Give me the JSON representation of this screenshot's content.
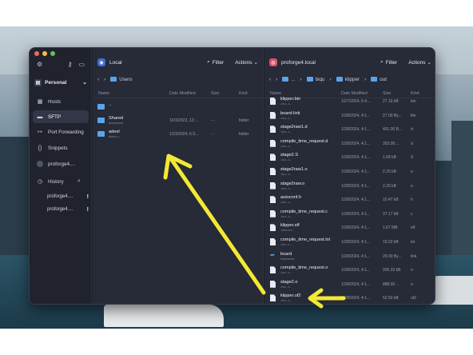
{
  "sidebar": {
    "vault_label": "Personal",
    "items": [
      {
        "label": "Hosts",
        "icon": "hosts-icon",
        "glyph": "▭"
      },
      {
        "label": "SFTP",
        "icon": "folder-icon",
        "glyph": "▬"
      },
      {
        "label": "Port Forwarding",
        "icon": "port-forwarding-icon",
        "glyph": "↦"
      },
      {
        "label": "Snippets",
        "icon": "snippets-icon",
        "glyph": "{}"
      },
      {
        "label": "proforge4....",
        "icon": "host-avatar-icon",
        "glyph": ""
      },
      {
        "label": "History",
        "icon": "history-icon",
        "glyph": "◷"
      }
    ],
    "history": [
      {
        "label": "proforge4....",
        "badge": "!"
      },
      {
        "label": "proforge4....",
        "badge": "!"
      }
    ]
  },
  "left_pane": {
    "host": "Local",
    "filter_label": "Filter",
    "actions_label": "Actions",
    "breadcrumb": [
      "Users"
    ],
    "columns": {
      "name": "Name",
      "date": "Date Modified",
      "size": "Size",
      "kind": "Kind"
    },
    "rows": [
      {
        "name": "..",
        "sub": "",
        "date": "",
        "size": "",
        "kind": "",
        "type": "folder"
      },
      {
        "name": "Shared",
        "sub": "drwxrwxrwt",
        "date": "10/3/2023, 12:...",
        "size": "- -",
        "kind": "folder",
        "type": "folder"
      },
      {
        "name": "adeel",
        "sub": "drwxr-x---",
        "date": "1/23/2024, 6:3...",
        "size": "- -",
        "kind": "folder",
        "type": "folder"
      }
    ]
  },
  "right_pane": {
    "host": "proforge4.local",
    "filter_label": "Filter",
    "actions_label": "Actions",
    "breadcrumb": [
      "...",
      "biqu",
      "klipper",
      "out"
    ],
    "columns": {
      "name": "Name",
      "date": "Date Modified",
      "size": "Size",
      "kind": "Kind"
    },
    "rows": [
      {
        "name": "klipper.bin",
        "sub": "-rw-r--r--",
        "date": "1/27/2024, 5:4...",
        "size": "27.16 kB",
        "kind": "bin",
        "type": "file"
      },
      {
        "name": "board-link",
        "sub": "-rw-r--r--",
        "date": "1/28/2024, 4:1...",
        "size": "27.00 By...",
        "kind": "file",
        "type": "file"
      },
      {
        "name": "stage2raw1.d",
        "sub": "-rw-r--r--",
        "date": "1/28/2024, 4:1...",
        "size": "401.00 B...",
        "kind": "d",
        "type": "file"
      },
      {
        "name": "compile_time_request.d",
        "sub": "-rw-r--r--",
        "date": "1/28/2024, 4:1...",
        "size": "353.00 ...",
        "kind": "d",
        "type": "file"
      },
      {
        "name": "stage2.S",
        "sub": "-rw-r--r--",
        "date": "1/28/2024, 4:1...",
        "size": "1.68 kB",
        "kind": "S",
        "type": "file"
      },
      {
        "name": "stage2raw1.o",
        "sub": "-rw-r--r--",
        "date": "1/28/2024, 4:1...",
        "size": "2.20 kB",
        "kind": "o",
        "type": "file"
      },
      {
        "name": "stage2raw.o",
        "sub": "-rw-r--r--",
        "date": "1/28/2024, 4:1...",
        "size": "2.20 kB",
        "kind": "o",
        "type": "file"
      },
      {
        "name": "autoconf.h",
        "sub": "-rw-r--r--",
        "date": "1/28/2024, 4:1...",
        "size": "10.47 kB",
        "kind": "h",
        "type": "file"
      },
      {
        "name": "compile_time_request.c",
        "sub": "-rw-r--r--",
        "date": "1/28/2024, 4:1...",
        "size": "37.17 kB",
        "kind": "c",
        "type": "file"
      },
      {
        "name": "klipper.elf",
        "sub": "-rwxr-xr-x",
        "date": "1/28/2024, 4:1...",
        "size": "1.67 MB",
        "kind": "elf",
        "type": "file"
      },
      {
        "name": "compile_time_request.txt",
        "sub": "-rw-r--r--",
        "date": "1/28/2024, 4:1...",
        "size": "15.02 kB",
        "kind": "txt",
        "type": "file"
      },
      {
        "name": "board",
        "sub": "lrwxrwxrwx",
        "date": "1/28/2024, 4:1...",
        "size": "29.00 By...",
        "kind": "link",
        "type": "link"
      },
      {
        "name": "compile_time_request.o",
        "sub": "-rw-r--r--",
        "date": "1/28/2024, 4:1...",
        "size": "200.33 kB",
        "kind": "o",
        "type": "file"
      },
      {
        "name": "stage2.o",
        "sub": "-rw-r--r--",
        "date": "1/28/2024, 4:1...",
        "size": "888.00 ...",
        "kind": "o",
        "type": "file"
      },
      {
        "name": "klipper.uf2",
        "sub": "-rw-r--r--",
        "date": "1/28/2024, 4:1...",
        "size": "52.50 kB",
        "kind": "uf2",
        "type": "file"
      }
    ]
  },
  "annotation_color": "#f3e935"
}
